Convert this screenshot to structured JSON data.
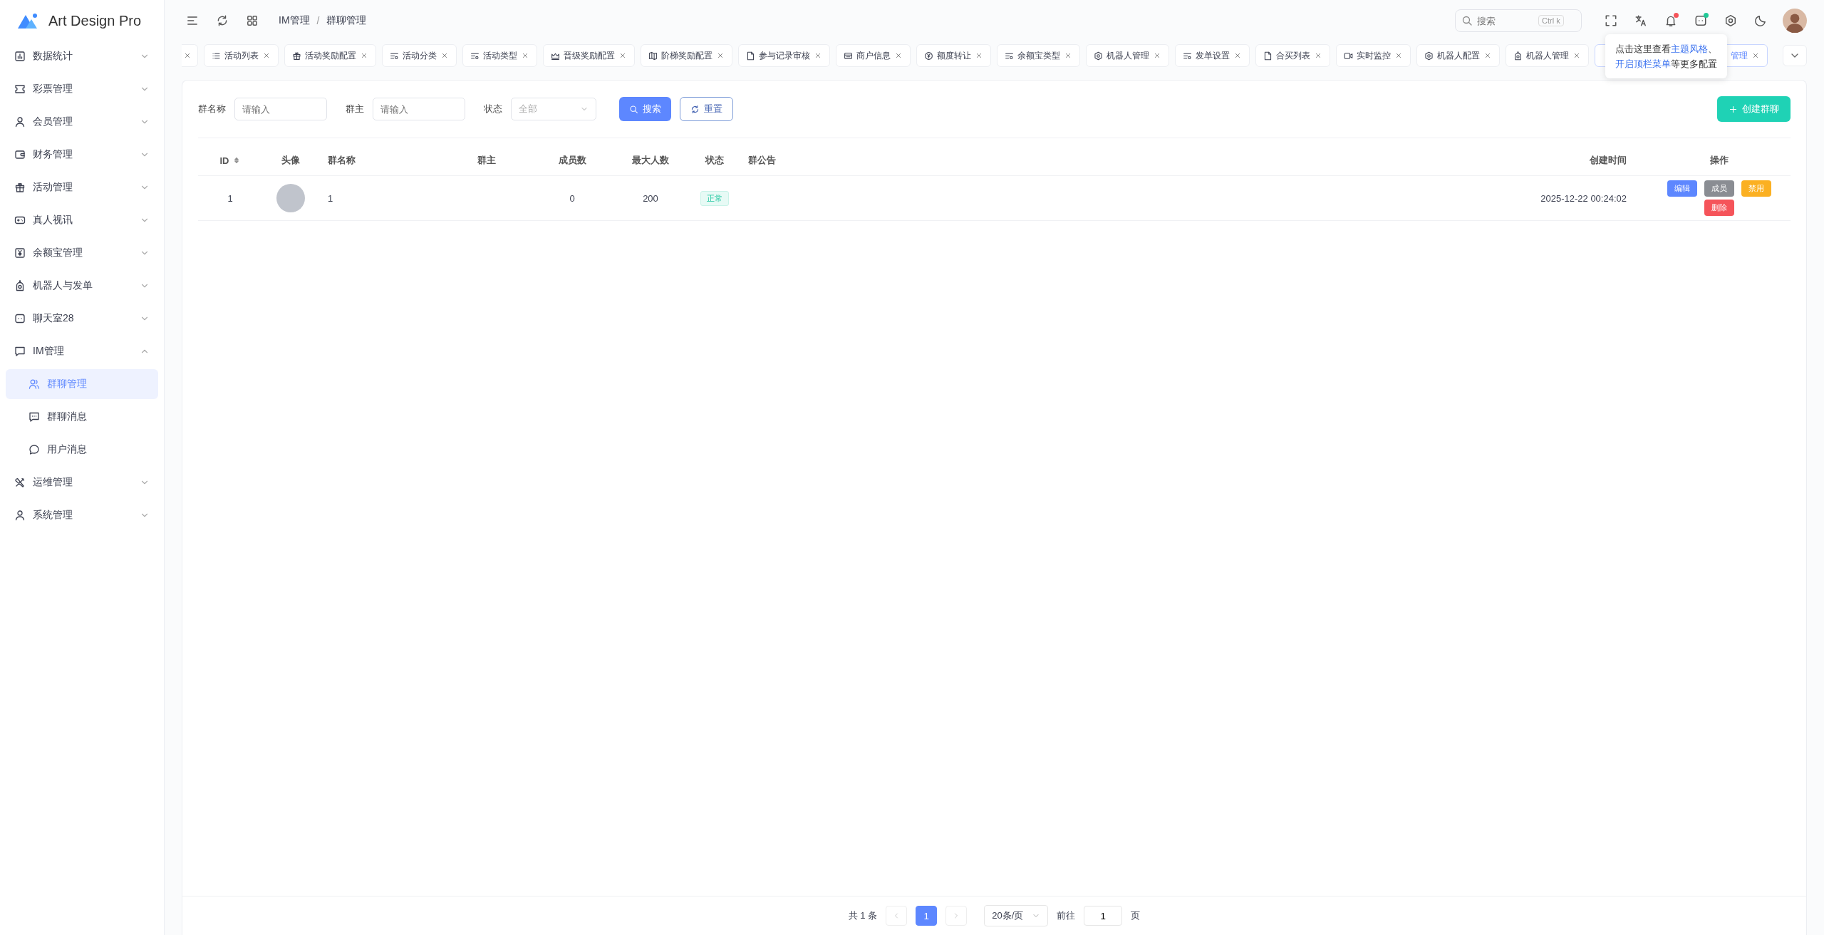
{
  "app": {
    "title": "Art Design Pro"
  },
  "sidebar": {
    "items": [
      {
        "label": "数据统计",
        "expanded": false,
        "selected": false
      },
      {
        "label": "彩票管理",
        "expanded": false,
        "selected": false
      },
      {
        "label": "会员管理",
        "expanded": false,
        "selected": false
      },
      {
        "label": "财务管理",
        "expanded": false,
        "selected": false
      },
      {
        "label": "活动管理",
        "expanded": false,
        "selected": false
      },
      {
        "label": "真人视讯",
        "expanded": false,
        "selected": false
      },
      {
        "label": "余额宝管理",
        "expanded": false,
        "selected": false
      },
      {
        "label": "机器人与发单",
        "expanded": false,
        "selected": false
      },
      {
        "label": "聊天室28",
        "expanded": false,
        "selected": false
      },
      {
        "label": "IM管理",
        "expanded": true,
        "selected": false,
        "children": [
          {
            "label": "群聊管理",
            "selected": true
          },
          {
            "label": "群聊消息",
            "selected": false
          },
          {
            "label": "用户消息",
            "selected": false
          }
        ]
      },
      {
        "label": "运维管理",
        "expanded": false,
        "selected": false
      },
      {
        "label": "系统管理",
        "expanded": false,
        "selected": false
      }
    ]
  },
  "header": {
    "breadcrumb": [
      "IM管理",
      "群聊管理"
    ],
    "breadcrumb_separator": "/",
    "search": {
      "placeholder": "搜索",
      "shortcut": "Ctrl k"
    },
    "notifications_unread": true,
    "messages_unread": true
  },
  "tabs": {
    "items": [
      {
        "kind": "clipped",
        "selected": false
      },
      {
        "label": "活动列表",
        "selected": false
      },
      {
        "label": "活动奖励配置",
        "selected": false
      },
      {
        "label": "活动分类",
        "selected": false
      },
      {
        "label": "活动类型",
        "selected": false
      },
      {
        "label": "晋级奖励配置",
        "selected": false
      },
      {
        "label": "阶梯奖励配置",
        "selected": false
      },
      {
        "label": "参与记录审核",
        "selected": false
      },
      {
        "label": "商户信息",
        "selected": false
      },
      {
        "label": "额度转让",
        "selected": false
      },
      {
        "label": "余额宝类型",
        "selected": false
      },
      {
        "label": "机器人管理",
        "selected": false
      },
      {
        "label": "发单设置",
        "selected": false
      },
      {
        "label": "合买列表",
        "selected": false
      },
      {
        "label": "实时监控",
        "selected": false
      },
      {
        "label": "机器人配置",
        "selected": false
      },
      {
        "label": "机器人管理",
        "selected": false
      },
      {
        "label": "管理",
        "kind": "covered",
        "selected": true
      }
    ]
  },
  "tooltip": {
    "lines": [
      [
        {
          "text": "点击这里查看"
        },
        {
          "text": "主题风格",
          "link": true
        },
        {
          "text": "、"
        }
      ],
      [
        {
          "text": "开启顶栏菜单",
          "link": true
        },
        {
          "text": "等更多配置"
        }
      ]
    ]
  },
  "filters": [
    {
      "label": "群名称",
      "kind": "text",
      "placeholder": "请输入"
    },
    {
      "label": "群主",
      "kind": "text",
      "placeholder": "请输入"
    },
    {
      "label": "状态",
      "kind": "select",
      "placeholder": "全部"
    }
  ],
  "actions": {
    "search": "搜索",
    "reset": "重置",
    "create": "创建群聊"
  },
  "table": {
    "columns": [
      {
        "label": "ID",
        "sortable": true
      },
      {
        "label": "头像"
      },
      {
        "label": "群名称"
      },
      {
        "label": "群主"
      },
      {
        "label": "成员数"
      },
      {
        "label": "最大人数"
      },
      {
        "label": "状态"
      },
      {
        "label": "群公告"
      },
      {
        "label": "创建时间"
      },
      {
        "label": "操作"
      }
    ],
    "rows": [
      {
        "id": "1",
        "name": "1",
        "members": "0",
        "max_members": "200",
        "status": {
          "label": "正常",
          "kind": "normal"
        },
        "created": "2025-12-22 00:24:02",
        "actions": [
          {
            "label": "编辑",
            "color": "#5d87ff"
          },
          {
            "label": "成员",
            "color": "#8a8d93"
          },
          {
            "label": "禁用",
            "color": "#fbb022"
          },
          {
            "label": "删除",
            "color": "#f5545a"
          }
        ]
      }
    ]
  },
  "pagination": {
    "total": "共 1 条",
    "prev_disabled": true,
    "next_disabled": true,
    "pages": [
      {
        "label": "1",
        "selected": true
      }
    ],
    "page_size": "20条/页",
    "goto_label": "前往",
    "goto_value": "1",
    "page_unit": "页"
  }
}
